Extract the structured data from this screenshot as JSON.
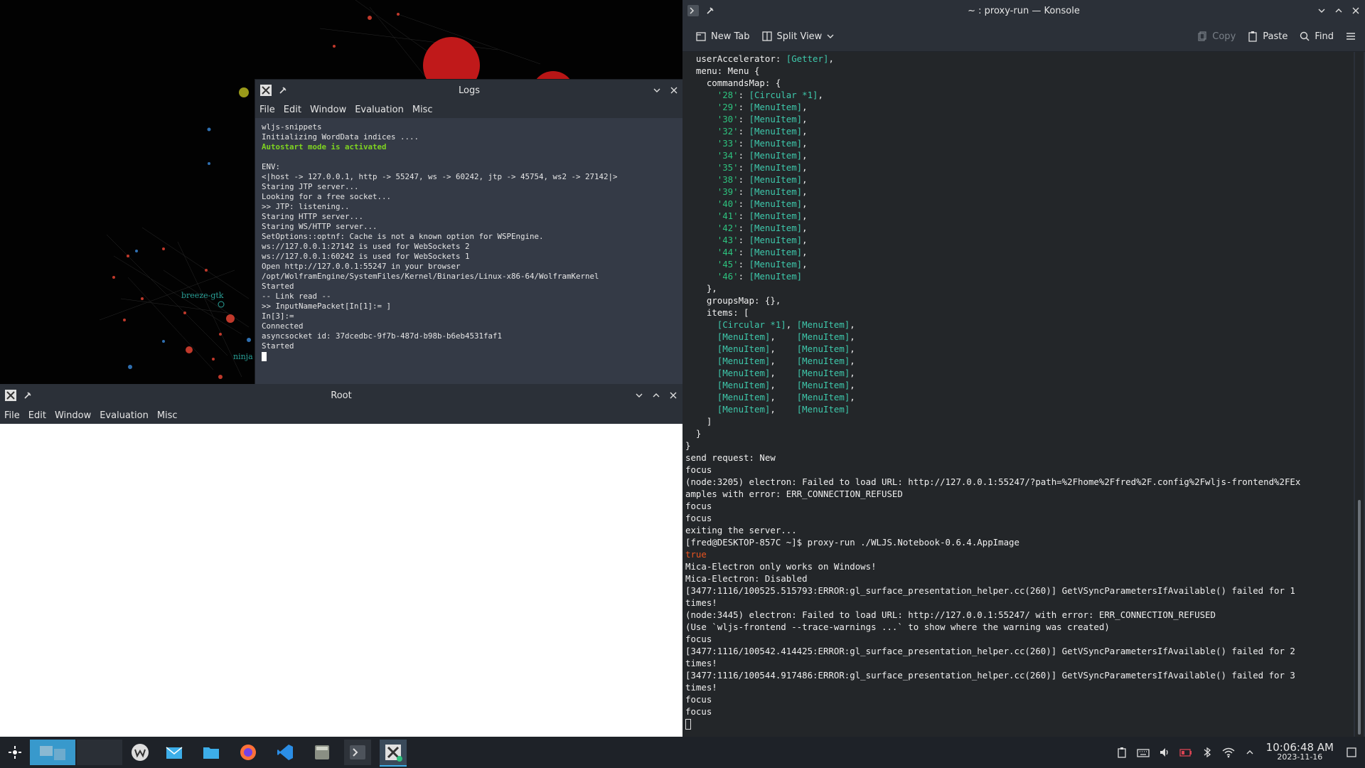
{
  "logs": {
    "title": "Logs",
    "menu": [
      "File",
      "Edit",
      "Window",
      "Evaluation",
      "Misc"
    ],
    "lines": [
      {
        "text": "wljs-snippets",
        "style": "normal"
      },
      {
        "text": "Initializing WordData indices ....",
        "style": "normal"
      },
      {
        "text": "Autostart mode is activated",
        "style": "green"
      },
      {
        "text": "",
        "style": "normal"
      },
      {
        "text": "ENV:",
        "style": "normal"
      },
      {
        "text": "<|host -> 127.0.0.1, http -> 55247, ws -> 60242, jtp -> 45754, ws2 -> 27142|>",
        "style": "normal"
      },
      {
        "text": "Staring JTP server...",
        "style": "normal"
      },
      {
        "text": "Looking for a free socket...",
        "style": "normal"
      },
      {
        "text": ">> JTP: listening..",
        "style": "normal"
      },
      {
        "text": "Staring HTTP server...",
        "style": "normal"
      },
      {
        "text": "Staring WS/HTTP server...",
        "style": "normal"
      },
      {
        "text": "SetOptions::optnf: Cache is not a known option for WSPEngine.",
        "style": "normal"
      },
      {
        "text": "ws://127.0.0.1:27142 is used for WebSockets 2",
        "style": "normal"
      },
      {
        "text": "ws://127.0.0.1:60242 is used for WebSockets 1",
        "style": "normal"
      },
      {
        "text": "Open http://127.0.0.1:55247 in your browser",
        "style": "normal"
      },
      {
        "text": "/opt/WolframEngine/SystemFiles/Kernel/Binaries/Linux-x86-64/WolframKernel",
        "style": "normal"
      },
      {
        "text": "Started",
        "style": "normal"
      },
      {
        "text": "-- Link read --",
        "style": "normal"
      },
      {
        "text": ">> InputNamePacket[In[1]:= ]",
        "style": "normal"
      },
      {
        "text": "In[3]:=",
        "style": "normal"
      },
      {
        "text": "Connected",
        "style": "normal"
      },
      {
        "text": "asyncsocket id: 37dcedbc-9f7b-487d-b98b-b6eb4531faf1",
        "style": "normal"
      },
      {
        "text": "Started",
        "style": "normal"
      }
    ]
  },
  "root": {
    "title": "Root",
    "menu": [
      "File",
      "Edit",
      "Window",
      "Evaluation",
      "Misc"
    ]
  },
  "desktop_labels": {
    "label1": "breeze-gtk",
    "label2": "ninja"
  },
  "konsole": {
    "title": "~ : proxy-run — Konsole",
    "toolbar": {
      "new_tab": "New Tab",
      "split_view": "Split View",
      "copy": "Copy",
      "paste": "Paste",
      "find": "Find"
    },
    "lines": [
      [
        {
          "t": "  userAccelerator: ",
          "c": ""
        },
        {
          "t": "[Getter]",
          "c": "t"
        },
        {
          "t": ",",
          "c": ""
        }
      ],
      [
        {
          "t": "  menu: Menu {",
          "c": ""
        }
      ],
      [
        {
          "t": "    commandsMap: {",
          "c": ""
        }
      ],
      [
        {
          "t": "      ",
          "c": ""
        },
        {
          "t": "'28'",
          "c": "g"
        },
        {
          "t": ": ",
          "c": ""
        },
        {
          "t": "[Circular *1]",
          "c": "t"
        },
        {
          "t": ",",
          "c": ""
        }
      ],
      [
        {
          "t": "      ",
          "c": ""
        },
        {
          "t": "'29'",
          "c": "g"
        },
        {
          "t": ": ",
          "c": ""
        },
        {
          "t": "[MenuItem]",
          "c": "t"
        },
        {
          "t": ",",
          "c": ""
        }
      ],
      [
        {
          "t": "      ",
          "c": ""
        },
        {
          "t": "'30'",
          "c": "g"
        },
        {
          "t": ": ",
          "c": ""
        },
        {
          "t": "[MenuItem]",
          "c": "t"
        },
        {
          "t": ",",
          "c": ""
        }
      ],
      [
        {
          "t": "      ",
          "c": ""
        },
        {
          "t": "'32'",
          "c": "g"
        },
        {
          "t": ": ",
          "c": ""
        },
        {
          "t": "[MenuItem]",
          "c": "t"
        },
        {
          "t": ",",
          "c": ""
        }
      ],
      [
        {
          "t": "      ",
          "c": ""
        },
        {
          "t": "'33'",
          "c": "g"
        },
        {
          "t": ": ",
          "c": ""
        },
        {
          "t": "[MenuItem]",
          "c": "t"
        },
        {
          "t": ",",
          "c": ""
        }
      ],
      [
        {
          "t": "      ",
          "c": ""
        },
        {
          "t": "'34'",
          "c": "g"
        },
        {
          "t": ": ",
          "c": ""
        },
        {
          "t": "[MenuItem]",
          "c": "t"
        },
        {
          "t": ",",
          "c": ""
        }
      ],
      [
        {
          "t": "      ",
          "c": ""
        },
        {
          "t": "'35'",
          "c": "g"
        },
        {
          "t": ": ",
          "c": ""
        },
        {
          "t": "[MenuItem]",
          "c": "t"
        },
        {
          "t": ",",
          "c": ""
        }
      ],
      [
        {
          "t": "      ",
          "c": ""
        },
        {
          "t": "'38'",
          "c": "g"
        },
        {
          "t": ": ",
          "c": ""
        },
        {
          "t": "[MenuItem]",
          "c": "t"
        },
        {
          "t": ",",
          "c": ""
        }
      ],
      [
        {
          "t": "      ",
          "c": ""
        },
        {
          "t": "'39'",
          "c": "g"
        },
        {
          "t": ": ",
          "c": ""
        },
        {
          "t": "[MenuItem]",
          "c": "t"
        },
        {
          "t": ",",
          "c": ""
        }
      ],
      [
        {
          "t": "      ",
          "c": ""
        },
        {
          "t": "'40'",
          "c": "g"
        },
        {
          "t": ": ",
          "c": ""
        },
        {
          "t": "[MenuItem]",
          "c": "t"
        },
        {
          "t": ",",
          "c": ""
        }
      ],
      [
        {
          "t": "      ",
          "c": ""
        },
        {
          "t": "'41'",
          "c": "g"
        },
        {
          "t": ": ",
          "c": ""
        },
        {
          "t": "[MenuItem]",
          "c": "t"
        },
        {
          "t": ",",
          "c": ""
        }
      ],
      [
        {
          "t": "      ",
          "c": ""
        },
        {
          "t": "'42'",
          "c": "g"
        },
        {
          "t": ": ",
          "c": ""
        },
        {
          "t": "[MenuItem]",
          "c": "t"
        },
        {
          "t": ",",
          "c": ""
        }
      ],
      [
        {
          "t": "      ",
          "c": ""
        },
        {
          "t": "'43'",
          "c": "g"
        },
        {
          "t": ": ",
          "c": ""
        },
        {
          "t": "[MenuItem]",
          "c": "t"
        },
        {
          "t": ",",
          "c": ""
        }
      ],
      [
        {
          "t": "      ",
          "c": ""
        },
        {
          "t": "'44'",
          "c": "g"
        },
        {
          "t": ": ",
          "c": ""
        },
        {
          "t": "[MenuItem]",
          "c": "t"
        },
        {
          "t": ",",
          "c": ""
        }
      ],
      [
        {
          "t": "      ",
          "c": ""
        },
        {
          "t": "'45'",
          "c": "g"
        },
        {
          "t": ": ",
          "c": ""
        },
        {
          "t": "[MenuItem]",
          "c": "t"
        },
        {
          "t": ",",
          "c": ""
        }
      ],
      [
        {
          "t": "      ",
          "c": ""
        },
        {
          "t": "'46'",
          "c": "g"
        },
        {
          "t": ": ",
          "c": ""
        },
        {
          "t": "[MenuItem]",
          "c": "t"
        }
      ],
      [
        {
          "t": "    },",
          "c": ""
        }
      ],
      [
        {
          "t": "    groupsMap: {},",
          "c": ""
        }
      ],
      [
        {
          "t": "    items: [",
          "c": ""
        }
      ],
      [
        {
          "t": "      ",
          "c": ""
        },
        {
          "t": "[Circular *1]",
          "c": "t"
        },
        {
          "t": ", ",
          "c": ""
        },
        {
          "t": "[MenuItem]",
          "c": "t"
        },
        {
          "t": ",",
          "c": ""
        }
      ],
      [
        {
          "t": "      ",
          "c": ""
        },
        {
          "t": "[MenuItem]",
          "c": "t"
        },
        {
          "t": ",    ",
          "c": ""
        },
        {
          "t": "[MenuItem]",
          "c": "t"
        },
        {
          "t": ",",
          "c": ""
        }
      ],
      [
        {
          "t": "      ",
          "c": ""
        },
        {
          "t": "[MenuItem]",
          "c": "t"
        },
        {
          "t": ",    ",
          "c": ""
        },
        {
          "t": "[MenuItem]",
          "c": "t"
        },
        {
          "t": ",",
          "c": ""
        }
      ],
      [
        {
          "t": "      ",
          "c": ""
        },
        {
          "t": "[MenuItem]",
          "c": "t"
        },
        {
          "t": ",    ",
          "c": ""
        },
        {
          "t": "[MenuItem]",
          "c": "t"
        },
        {
          "t": ",",
          "c": ""
        }
      ],
      [
        {
          "t": "      ",
          "c": ""
        },
        {
          "t": "[MenuItem]",
          "c": "t"
        },
        {
          "t": ",    ",
          "c": ""
        },
        {
          "t": "[MenuItem]",
          "c": "t"
        },
        {
          "t": ",",
          "c": ""
        }
      ],
      [
        {
          "t": "      ",
          "c": ""
        },
        {
          "t": "[MenuItem]",
          "c": "t"
        },
        {
          "t": ",    ",
          "c": ""
        },
        {
          "t": "[MenuItem]",
          "c": "t"
        },
        {
          "t": ",",
          "c": ""
        }
      ],
      [
        {
          "t": "      ",
          "c": ""
        },
        {
          "t": "[MenuItem]",
          "c": "t"
        },
        {
          "t": ",    ",
          "c": ""
        },
        {
          "t": "[MenuItem]",
          "c": "t"
        },
        {
          "t": ",",
          "c": ""
        }
      ],
      [
        {
          "t": "      ",
          "c": ""
        },
        {
          "t": "[MenuItem]",
          "c": "t"
        },
        {
          "t": ",    ",
          "c": ""
        },
        {
          "t": "[MenuItem]",
          "c": "t"
        }
      ],
      [
        {
          "t": "    ]",
          "c": ""
        }
      ],
      [
        {
          "t": "  }",
          "c": ""
        }
      ],
      [
        {
          "t": "}",
          "c": ""
        }
      ],
      [
        {
          "t": "send request: New",
          "c": ""
        }
      ],
      [
        {
          "t": "focus",
          "c": ""
        }
      ],
      [
        {
          "t": "(node:3205) electron: Failed to load URL: http://127.0.0.1:55247/?path=%2Fhome%2Ffred%2F.config%2Fwljs-frontend%2FEx",
          "c": ""
        }
      ],
      [
        {
          "t": "amples with error: ERR_CONNECTION_REFUSED",
          "c": ""
        }
      ],
      [
        {
          "t": "focus",
          "c": ""
        }
      ],
      [
        {
          "t": "focus",
          "c": ""
        }
      ],
      [
        {
          "t": "exiting the server...",
          "c": ""
        }
      ],
      [
        {
          "t": "[fred@DESKTOP-857C ~]$ proxy-run ./WLJS.Notebook-0.6.4.AppImage",
          "c": ""
        }
      ],
      [
        {
          "t": "true",
          "c": "r"
        }
      ],
      [
        {
          "t": "Mica-Electron only works on Windows!",
          "c": ""
        }
      ],
      [
        {
          "t": "Mica-Electron: Disabled",
          "c": ""
        }
      ],
      [
        {
          "t": "[3477:1116/100525.515793:ERROR:gl_surface_presentation_helper.cc(260)] GetVSyncParametersIfAvailable() failed for 1",
          "c": ""
        }
      ],
      [
        {
          "t": "times!",
          "c": ""
        }
      ],
      [
        {
          "t": "(node:3445) electron: Failed to load URL: http://127.0.0.1:55247/ with error: ERR_CONNECTION_REFUSED",
          "c": ""
        }
      ],
      [
        {
          "t": "(Use `wljs-frontend --trace-warnings ...` to show where the warning was created)",
          "c": ""
        }
      ],
      [
        {
          "t": "focus",
          "c": ""
        }
      ],
      [
        {
          "t": "[3477:1116/100542.414425:ERROR:gl_surface_presentation_helper.cc(260)] GetVSyncParametersIfAvailable() failed for 2",
          "c": ""
        }
      ],
      [
        {
          "t": "times!",
          "c": ""
        }
      ],
      [
        {
          "t": "[3477:1116/100544.917486:ERROR:gl_surface_presentation_helper.cc(260)] GetVSyncParametersIfAvailable() failed for 3",
          "c": ""
        }
      ],
      [
        {
          "t": "times!",
          "c": ""
        }
      ],
      [
        {
          "t": "focus",
          "c": ""
        }
      ],
      [
        {
          "t": "focus",
          "c": ""
        }
      ]
    ]
  },
  "taskbar": {
    "apps": [
      "app-launcher",
      "virtual-desktop-1",
      "virtual-desktop-2",
      "wolfram-app",
      "mail-app",
      "file-manager",
      "firefox",
      "vscode",
      "calculator-app",
      "konsole-app",
      "wljs-app"
    ],
    "clock_time": "10:06:48 AM",
    "clock_date": "2023-11-16"
  },
  "colors": {
    "window_bg": "#2b3038",
    "terminal_bg": "#232629",
    "terminal_green": "#2ec27e",
    "terminal_teal": "#3ec8ab",
    "accent_blue": "#3daee9"
  }
}
